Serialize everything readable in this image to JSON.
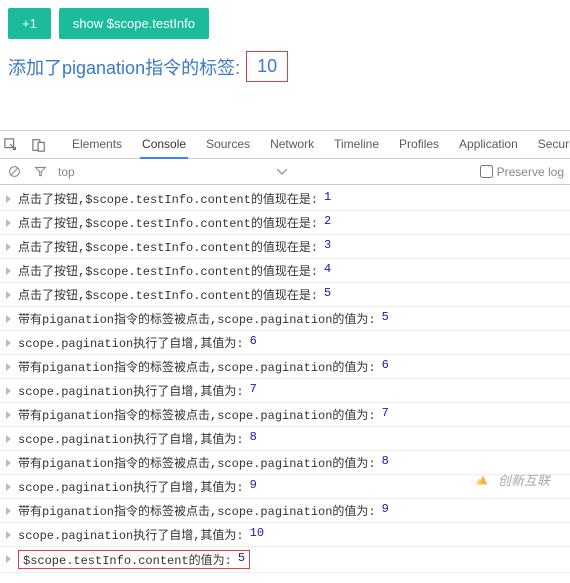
{
  "top": {
    "btn_plus": "+1",
    "btn_show": "show $scope.testInfo",
    "label": "添加了piganation指令的标签:",
    "value": "10"
  },
  "devtools": {
    "tabs": [
      "Elements",
      "Console",
      "Sources",
      "Network",
      "Timeline",
      "Profiles",
      "Application",
      "Security"
    ],
    "active_tab": "Console",
    "scope": "top",
    "preserve_label": "Preserve log",
    "preserve_checked": false
  },
  "logs": [
    {
      "text": "点击了按钮,$scope.testInfo.content的值现在是:",
      "num": "1"
    },
    {
      "text": "点击了按钮,$scope.testInfo.content的值现在是:",
      "num": "2"
    },
    {
      "text": "点击了按钮,$scope.testInfo.content的值现在是:",
      "num": "3"
    },
    {
      "text": "点击了按钮,$scope.testInfo.content的值现在是:",
      "num": "4"
    },
    {
      "text": "点击了按钮,$scope.testInfo.content的值现在是:",
      "num": "5"
    },
    {
      "text": "带有piganation指令的标签被点击,scope.pagination的值为:",
      "num": "5"
    },
    {
      "text": "scope.pagination执行了自增,其值为:",
      "num": "6"
    },
    {
      "text": "带有piganation指令的标签被点击,scope.pagination的值为:",
      "num": "6"
    },
    {
      "text": "scope.pagination执行了自增,其值为:",
      "num": "7"
    },
    {
      "text": "带有piganation指令的标签被点击,scope.pagination的值为:",
      "num": "7"
    },
    {
      "text": "scope.pagination执行了自增,其值为:",
      "num": "8"
    },
    {
      "text": "带有piganation指令的标签被点击,scope.pagination的值为:",
      "num": "8"
    },
    {
      "text": "scope.pagination执行了自增,其值为:",
      "num": "9"
    },
    {
      "text": "带有piganation指令的标签被点击,scope.pagination的值为:",
      "num": "9"
    },
    {
      "text": "scope.pagination执行了自增,其值为:",
      "num": "10"
    },
    {
      "text": "$scope.testInfo.content的值为:",
      "num": "5",
      "highlight": true
    }
  ],
  "watermark": "创新互联"
}
